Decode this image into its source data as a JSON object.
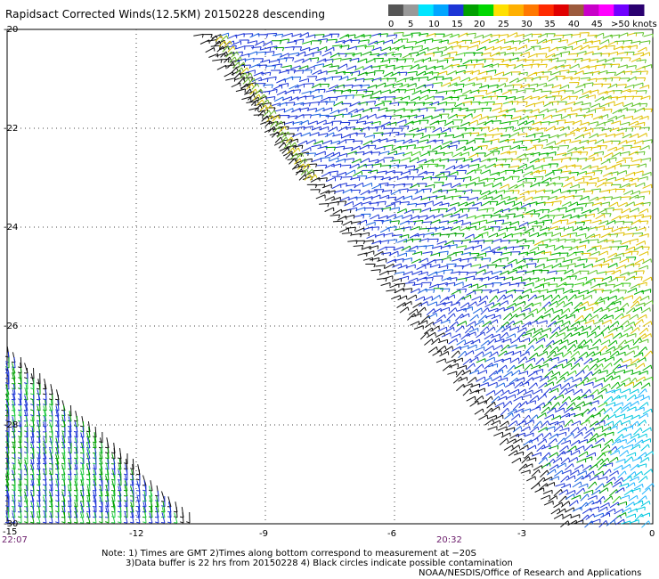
{
  "title": "Rapidsact Corrected Winds(12.5KM) 20150228 descending",
  "legend": {
    "labels": [
      "0",
      "5",
      "10",
      "15",
      "20",
      "25",
      "30",
      "35",
      "40",
      "45",
      ">50 knots"
    ],
    "colors": [
      "#555555",
      "#999999",
      "#00e5ff",
      "#00a6ff",
      "#1d35d6",
      "#00a000",
      "#00d700",
      "#ffe000",
      "#ffb000",
      "#ff7800",
      "#ff2a00",
      "#e00000",
      "#9c5a3c",
      "#c800c8",
      "#ff00ff",
      "#7000ff",
      "#2a0070"
    ]
  },
  "axes": {
    "x_ticks": [
      "-15",
      "-12",
      "-9",
      "-6",
      "-3",
      "0"
    ],
    "y_ticks": [
      "-20",
      "-22",
      "-24",
      "-26",
      "-28",
      "-30"
    ]
  },
  "time_labels": {
    "left": "22:07",
    "middle": "20:32"
  },
  "notes": {
    "line1": "Note: 1) Times are GMT 2)Times along bottom correspond to measurement at −20S",
    "line2": "3)Data buffer is 22 hrs from 20150228 4) Black circles indicate possible contamination",
    "credit": "NOAA/NESDIS/Office of Research and Applications"
  }
}
